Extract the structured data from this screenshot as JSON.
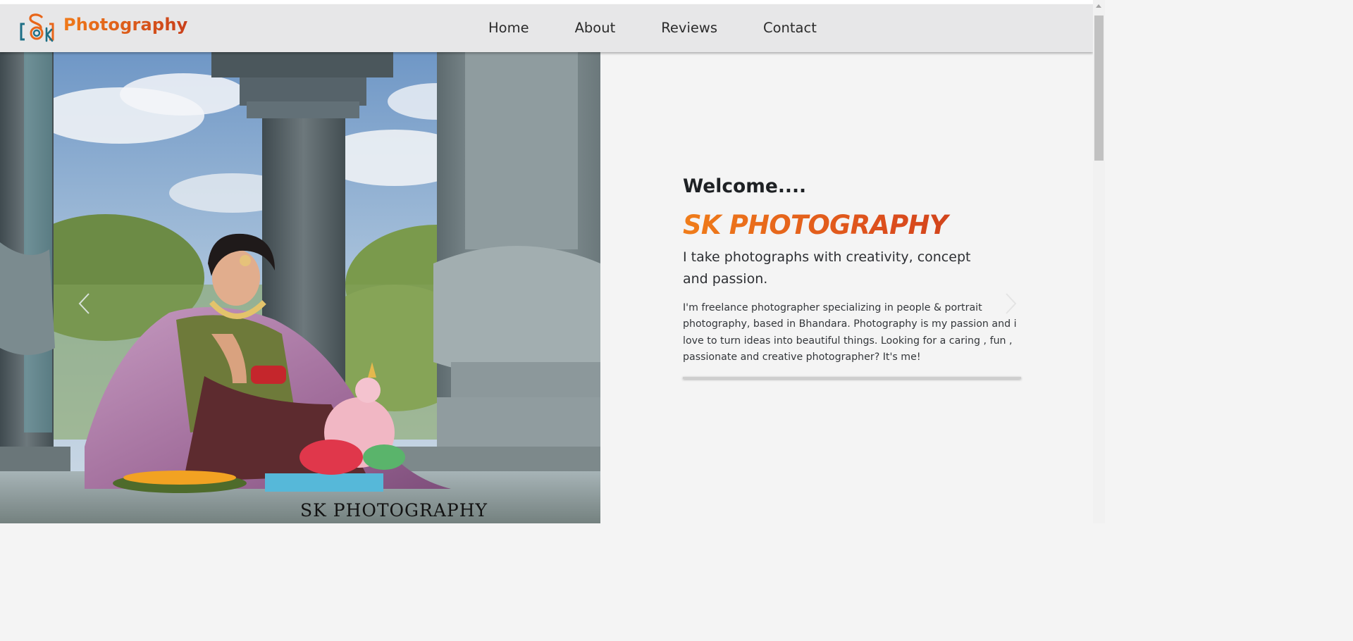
{
  "header": {
    "brand_text": "Photography",
    "logo_letters": "SK",
    "nav": [
      {
        "label": "Home"
      },
      {
        "label": "About"
      },
      {
        "label": "Reviews"
      },
      {
        "label": "Contact"
      }
    ]
  },
  "hero": {
    "image_caption": "SK PHOTOGRAPHY"
  },
  "intro": {
    "welcome": "Welcome....",
    "title": "SK PHOTOGRAPHY",
    "tagline": "I take photographs with creativity, concept and passion.",
    "bio": "I'm freelance photographer specializing in people & portrait photography, based in Bhandara. Photography is my passion and i love to turn ideas into beautiful things. Looking for a caring , fun , passionate and creative photographer? It's me!"
  },
  "colors": {
    "accent_orange": "#e8661a",
    "accent_red": "#c9401b",
    "navbar_bg": "#e7e7e8",
    "page_bg": "#f4f4f4",
    "logo_teal": "#1d6f86"
  },
  "icons": {
    "carousel_prev": "chevron-left-icon",
    "carousel_next": "chevron-right-icon",
    "logo": "sk-logo-icon"
  }
}
